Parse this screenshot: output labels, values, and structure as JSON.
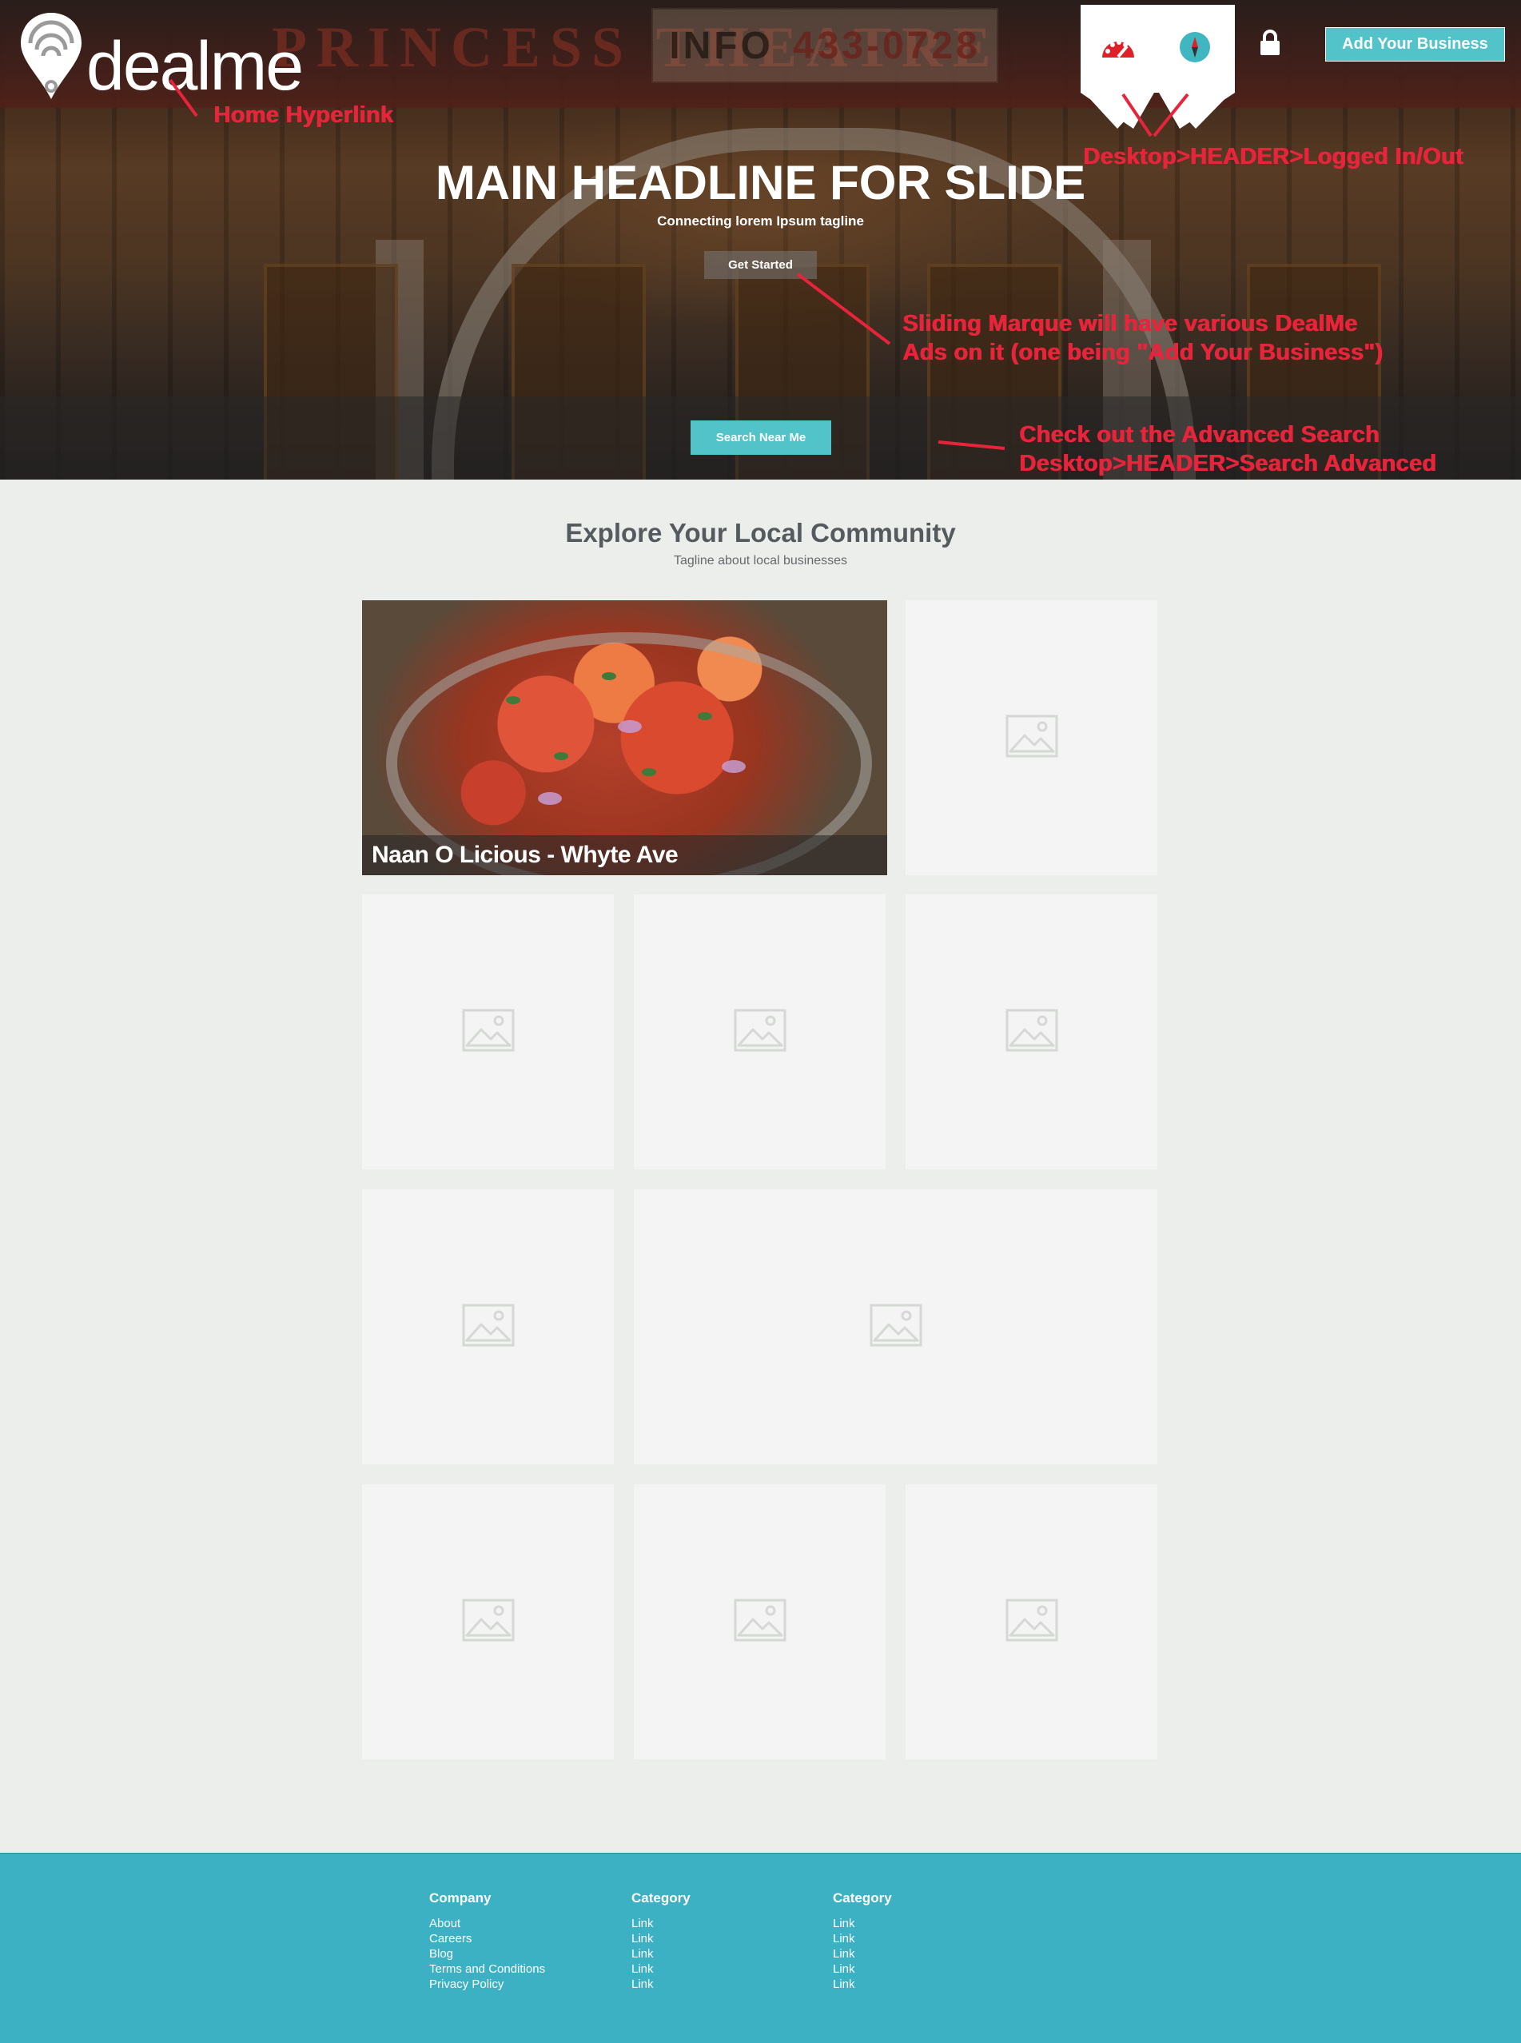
{
  "header": {
    "logo_text": "dealme",
    "add_business_label": "Add Your Business",
    "icons": [
      "dashboard-gauge-icon",
      "compass-icon",
      "lock-icon",
      "location-pin-logo-icon"
    ]
  },
  "hero": {
    "background_sign": {
      "marquee_letters": "PRINCESS THEATRE",
      "info_label": "INFO",
      "info_number": "433-0728"
    },
    "headline": "MAIN HEADLINE FOR SLIDE",
    "tagline": "Connecting lorem Ipsum tagline",
    "cta_label": "Get Started",
    "search_label": "Search Near Me"
  },
  "annotations": {
    "home": "Home Hyperlink",
    "header": "Desktop>HEADER>Logged In/Out",
    "marque_line1": "Sliding Marque will have various DealMe",
    "marque_line2": "Ads on it (one being \"Add Your Business\")",
    "search_line1": "Check out the Advanced Search",
    "search_line2": "Desktop>HEADER>Search Advanced"
  },
  "explore": {
    "title": "Explore Your Local Community",
    "tagline": "Tagline about local businesses",
    "featured_caption": "Naan O Licious - Whyte Ave"
  },
  "footer": {
    "columns": [
      {
        "heading": "Company",
        "links": [
          "About",
          "Careers",
          "Blog",
          "Terms and Conditions",
          "Privacy Policy"
        ]
      },
      {
        "heading": "Category",
        "links": [
          "Link",
          "Link",
          "Link",
          "Link",
          "Link"
        ]
      },
      {
        "heading": "Category",
        "links": [
          "Link",
          "Link",
          "Link",
          "Link",
          "Link"
        ]
      }
    ]
  },
  "colors": {
    "accent_teal": "#52c3c9",
    "footer_teal": "#3bb1c3",
    "annotation_red": "#e8243b",
    "page_bg": "#eceeeb",
    "placeholder_bg": "#f3f4f3"
  }
}
